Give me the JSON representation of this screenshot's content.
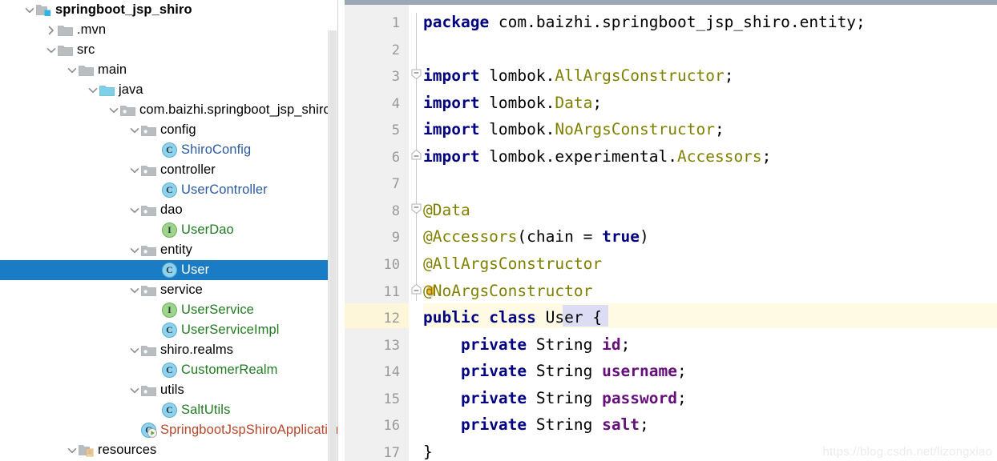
{
  "project": {
    "scrollbar": {
      "name": "project-vertical-scrollbar"
    },
    "tree": [
      {
        "label": "springboot_jsp_shiro",
        "icon": "module-icon",
        "indent": 45,
        "twisty": "expanded",
        "style": "bold",
        "level": 0
      },
      {
        "label": ".mvn",
        "icon": "folder-icon",
        "indent": 72,
        "twisty": "collapsed",
        "style": "plain",
        "level": 1
      },
      {
        "label": "src",
        "icon": "folder-icon",
        "indent": 72,
        "twisty": "expanded",
        "style": "plain",
        "level": 1
      },
      {
        "label": "main",
        "icon": "folder-icon",
        "indent": 98,
        "twisty": "expanded",
        "style": "plain",
        "level": 2
      },
      {
        "label": "java",
        "icon": "source-root-folder-icon",
        "indent": 124,
        "twisty": "expanded",
        "style": "plain",
        "level": 3
      },
      {
        "label": "com.baizhi.springboot_jsp_shiro",
        "icon": "package-icon",
        "indent": 150,
        "twisty": "expanded",
        "style": "plain",
        "level": 4
      },
      {
        "label": "config",
        "icon": "package-icon",
        "indent": 176,
        "twisty": "expanded",
        "style": "plain",
        "level": 5
      },
      {
        "label": "ShiroConfig",
        "icon": "java-class-icon",
        "indent": 202,
        "twisty": "none",
        "style": "blue",
        "level": 6
      },
      {
        "label": "controller",
        "icon": "package-icon",
        "indent": 176,
        "twisty": "expanded",
        "style": "plain",
        "level": 5
      },
      {
        "label": "UserController",
        "icon": "java-class-icon",
        "indent": 202,
        "twisty": "none",
        "style": "blue",
        "level": 6
      },
      {
        "label": "dao",
        "icon": "package-icon",
        "indent": 176,
        "twisty": "expanded",
        "style": "plain",
        "level": 5
      },
      {
        "label": "UserDao",
        "icon": "java-interface-icon",
        "indent": 202,
        "twisty": "none",
        "style": "green",
        "level": 6
      },
      {
        "label": "entity",
        "icon": "package-icon",
        "indent": 176,
        "twisty": "expanded",
        "style": "plain",
        "level": 5
      },
      {
        "label": "User",
        "icon": "java-class-icon",
        "indent": 202,
        "twisty": "none",
        "style": "plain",
        "level": 6,
        "selected": true
      },
      {
        "label": "service",
        "icon": "package-icon",
        "indent": 176,
        "twisty": "expanded",
        "style": "plain",
        "level": 5
      },
      {
        "label": "UserService",
        "icon": "java-interface-icon",
        "indent": 202,
        "twisty": "none",
        "style": "green",
        "level": 6
      },
      {
        "label": "UserServiceImpl",
        "icon": "java-class-icon",
        "indent": 202,
        "twisty": "none",
        "style": "green",
        "level": 6
      },
      {
        "label": "shiro.realms",
        "icon": "package-icon",
        "indent": 176,
        "twisty": "expanded",
        "style": "plain",
        "level": 5
      },
      {
        "label": "CustomerRealm",
        "icon": "java-class-icon",
        "indent": 202,
        "twisty": "none",
        "style": "green",
        "level": 6
      },
      {
        "label": "utils",
        "icon": "package-icon",
        "indent": 176,
        "twisty": "expanded",
        "style": "plain",
        "level": 5
      },
      {
        "label": "SaltUtils",
        "icon": "java-class-icon",
        "indent": 202,
        "twisty": "none",
        "style": "green",
        "level": 6
      },
      {
        "label": "SpringbootJspShiroApplication",
        "icon": "java-runnable-class-icon",
        "indent": 176,
        "twisty": "none",
        "style": "brown",
        "level": 5
      },
      {
        "label": "resources",
        "icon": "resource-root-folder-icon",
        "indent": 98,
        "twisty": "expanded",
        "style": "plain",
        "level": 2
      }
    ]
  },
  "editor": {
    "current_line": 12,
    "line_numbers": [
      "1",
      "2",
      "3",
      "4",
      "5",
      "6",
      "7",
      "8",
      "9",
      "10",
      "11",
      "12",
      "13",
      "14",
      "15",
      "16",
      "17"
    ],
    "lines": [
      {
        "n": "1",
        "tokens": [
          {
            "t": "package",
            "c": "kw"
          },
          {
            "t": " com.baizhi.springboot_jsp_shiro.entity;",
            "c": "plain"
          }
        ]
      },
      {
        "n": "2",
        "tokens": []
      },
      {
        "n": "3",
        "tokens": [
          {
            "t": "import",
            "c": "kw"
          },
          {
            "t": " lombok.",
            "c": "plain"
          },
          {
            "t": "AllArgsConstructor",
            "c": "type"
          },
          {
            "t": ";",
            "c": "plain"
          }
        ],
        "fold": "start"
      },
      {
        "n": "4",
        "tokens": [
          {
            "t": "import",
            "c": "kw"
          },
          {
            "t": " lombok.",
            "c": "plain"
          },
          {
            "t": "Data",
            "c": "type"
          },
          {
            "t": ";",
            "c": "plain"
          }
        ]
      },
      {
        "n": "5",
        "tokens": [
          {
            "t": "import",
            "c": "kw"
          },
          {
            "t": " lombok.",
            "c": "plain"
          },
          {
            "t": "NoArgsConstructor",
            "c": "type"
          },
          {
            "t": ";",
            "c": "plain"
          }
        ]
      },
      {
        "n": "6",
        "tokens": [
          {
            "t": "import",
            "c": "kw"
          },
          {
            "t": " lombok.experimental.",
            "c": "plain"
          },
          {
            "t": "Accessors",
            "c": "type"
          },
          {
            "t": ";",
            "c": "plain"
          }
        ],
        "fold": "end"
      },
      {
        "n": "7",
        "tokens": []
      },
      {
        "n": "8",
        "tokens": [
          {
            "t": "@Data",
            "c": "anno"
          }
        ],
        "fold": "start"
      },
      {
        "n": "9",
        "tokens": [
          {
            "t": "@Accessors",
            "c": "anno"
          },
          {
            "t": "(chain = ",
            "c": "plain"
          },
          {
            "t": "true",
            "c": "kw"
          },
          {
            "t": ")",
            "c": "plain"
          }
        ]
      },
      {
        "n": "10",
        "tokens": [
          {
            "t": "@AllArgsConstructor",
            "c": "anno"
          }
        ]
      },
      {
        "n": "11",
        "tokens": [
          {
            "t": "@NoArgsConstructor",
            "c": "anno"
          }
        ],
        "fold": "end"
      },
      {
        "n": "12",
        "tokens": [
          {
            "t": "public",
            "c": "kw"
          },
          {
            "t": " ",
            "c": "plain"
          },
          {
            "t": "class",
            "c": "kw"
          },
          {
            "t": " User {",
            "c": "plain"
          }
        ]
      },
      {
        "n": "13",
        "tokens": [
          {
            "t": "    ",
            "c": "plain"
          },
          {
            "t": "private",
            "c": "kw"
          },
          {
            "t": " String ",
            "c": "plain"
          },
          {
            "t": "id",
            "c": "fld"
          },
          {
            "t": ";",
            "c": "plain"
          }
        ]
      },
      {
        "n": "14",
        "tokens": [
          {
            "t": "    ",
            "c": "plain"
          },
          {
            "t": "private",
            "c": "kw"
          },
          {
            "t": " String ",
            "c": "plain"
          },
          {
            "t": "username",
            "c": "fld"
          },
          {
            "t": ";",
            "c": "plain"
          }
        ]
      },
      {
        "n": "15",
        "tokens": [
          {
            "t": "    ",
            "c": "plain"
          },
          {
            "t": "private",
            "c": "kw"
          },
          {
            "t": " String ",
            "c": "plain"
          },
          {
            "t": "password",
            "c": "fld"
          },
          {
            "t": ";",
            "c": "plain"
          }
        ]
      },
      {
        "n": "16",
        "tokens": [
          {
            "t": "    ",
            "c": "plain"
          },
          {
            "t": "private",
            "c": "kw"
          },
          {
            "t": " String ",
            "c": "plain"
          },
          {
            "t": "salt",
            "c": "fld"
          },
          {
            "t": ";",
            "c": "plain"
          }
        ]
      },
      {
        "n": "17",
        "tokens": [
          {
            "t": "}",
            "c": "plain"
          }
        ]
      }
    ]
  },
  "watermark": {
    "text": "https://blog.csdn.net/lizongxiao"
  },
  "colors": {
    "selection_blue": "#1a7cc4",
    "keyword": "#000080",
    "annotation": "#808000",
    "field": "#660e7a",
    "current_line": "#fffae3",
    "identifier_highlight": "#dcdcf5",
    "gutter_bg": "#f0f0f0"
  }
}
